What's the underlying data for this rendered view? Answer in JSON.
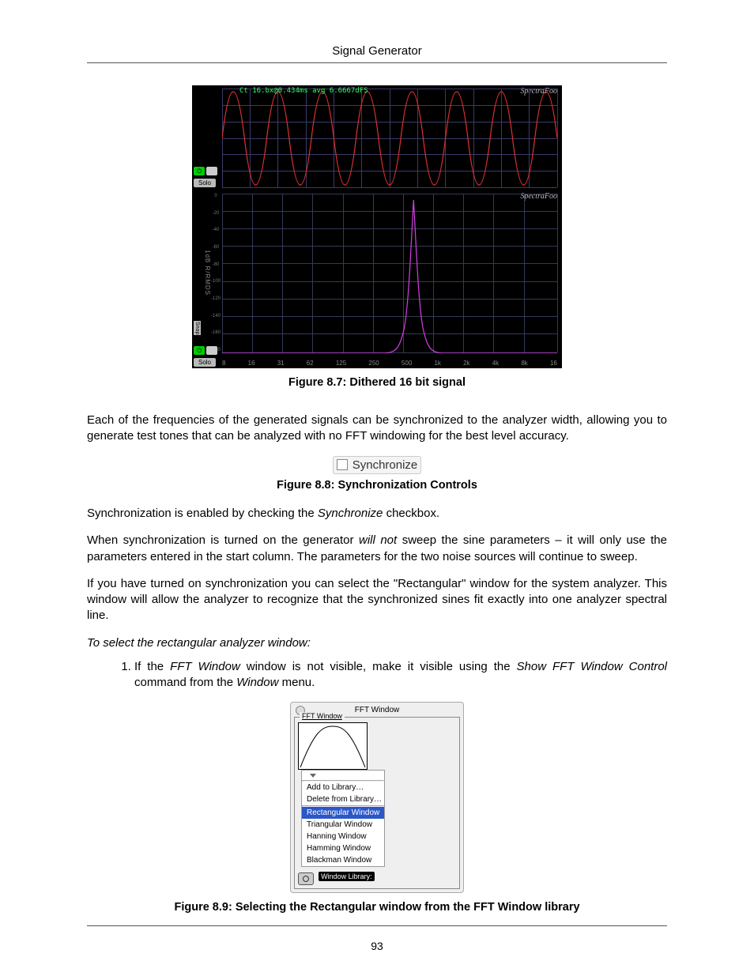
{
  "header_title": "Signal Generator",
  "page_number": "93",
  "figure87": {
    "caption": "Figure 8.7: Dithered 16 bit signal",
    "brand": "SpectraFoo",
    "top_info": "Ct 16.bx@0.434ms avg 6.6667dFS",
    "solo_label": "Solo",
    "spectrum": {
      "ylabel": "1dB R/RMDS",
      "xticks": [
        "8",
        "16",
        "31",
        "62",
        "125",
        "250",
        "500",
        "1k",
        "2k",
        "4k",
        "8k",
        "16"
      ],
      "snap": "Snap"
    }
  },
  "para1": "Each of the frequencies of the generated signals can be synchronized to the analyzer width, allowing you to generate test tones that can be analyzed with no FFT windowing for the best level accuracy.",
  "figure88": {
    "checkbox_label": "Synchronize",
    "caption": "Figure 8.8: Synchronization Controls"
  },
  "para2_a": "Synchronization is enabled by checking the ",
  "para2_b": "Synchronize",
  "para2_c": " checkbox.",
  "para3_a": "When synchronization is turned on the generator ",
  "para3_b": "will not",
  "para3_c": " sweep the sine parameters – it will only use the parameters entered in the start column. The parameters for the two noise sources will continue to sweep.",
  "para4": "If you have turned on synchronization you can select the \"Rectangular\" window for the system analyzer. This window will allow the analyzer to recognize that the synchronized sines fit exactly into one analyzer spectral line.",
  "instruct": "To select the rectangular analyzer window:",
  "step1_a": "If the ",
  "step1_b": "FFT Window",
  "step1_c": " window is not visible, make it visible using the ",
  "step1_d": "Show FFT Window Control",
  "step1_e": " command from the ",
  "step1_f": "Window",
  "step1_g": " menu.",
  "figure89": {
    "title": "FFT Window",
    "group_label": "FFT Window",
    "lib_label": "Window Library:",
    "menu": {
      "add": "Add to Library…",
      "del": "Delete from Library…",
      "items": [
        "Rectangular Window",
        "Triangular Window",
        "Hanning Window",
        "Hamming Window",
        "Blackman Window"
      ],
      "selected": 0
    },
    "caption": "Figure 8.9: Selecting the Rectangular window from the FFT Window library"
  }
}
